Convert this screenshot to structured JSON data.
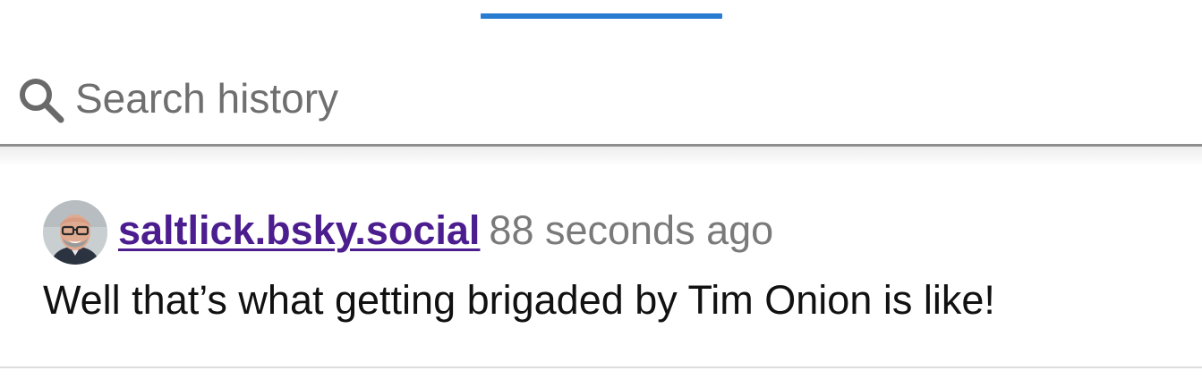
{
  "search": {
    "placeholder": "Search history",
    "icon": "search-icon"
  },
  "colors": {
    "accent": "#2a7bd2",
    "link": "#4b1d8f",
    "muted": "#7a7a7a"
  },
  "history": {
    "items": [
      {
        "avatar": "user-avatar",
        "handle": "saltlick.bsky.social",
        "time": "88 seconds ago",
        "text": "Well that’s what getting brigaded by Tim Onion is like!"
      }
    ]
  }
}
